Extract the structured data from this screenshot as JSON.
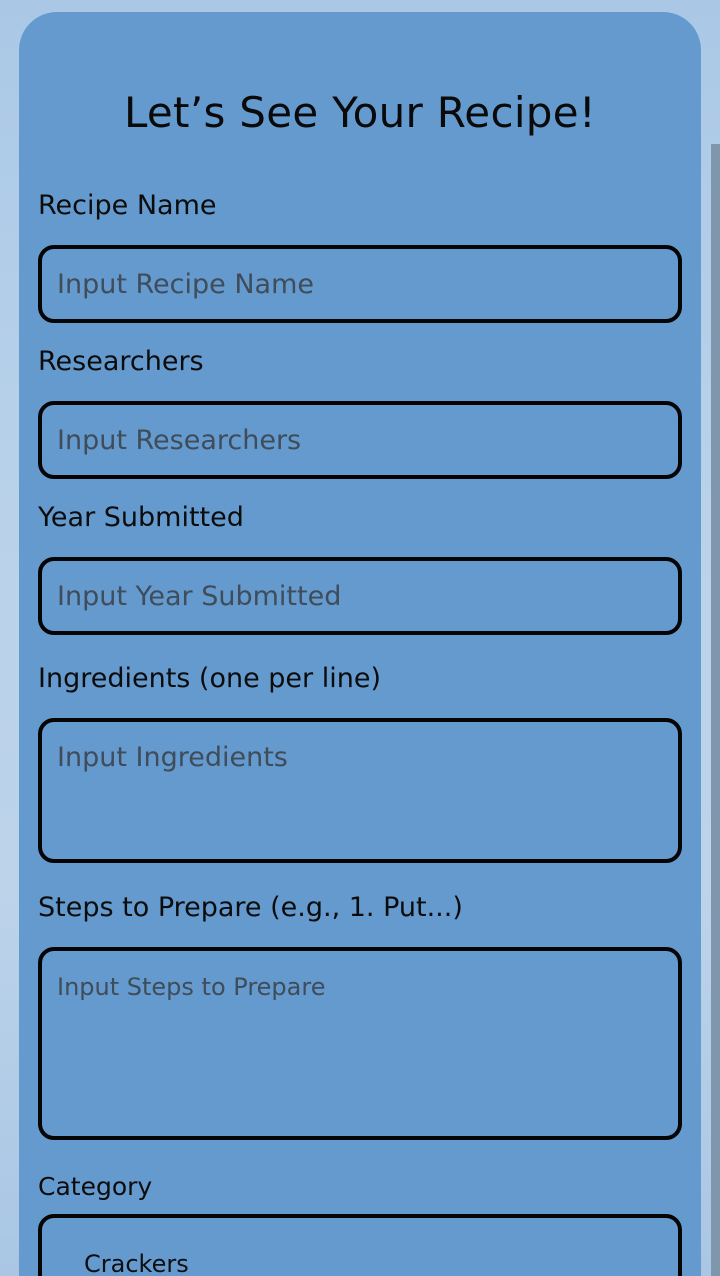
{
  "form": {
    "title": "Let’s See Your Recipe!",
    "recipe_name": {
      "label": "Recipe Name",
      "placeholder": "Input Recipe Name",
      "value": ""
    },
    "researchers": {
      "label": "Researchers",
      "placeholder": "Input Researchers",
      "value": ""
    },
    "year_submitted": {
      "label": "Year Submitted",
      "placeholder": "Input Year Submitted",
      "value": ""
    },
    "ingredients": {
      "label": "Ingredients (one per line)",
      "placeholder": "Input Ingredients",
      "value": ""
    },
    "steps": {
      "label": "Steps to Prepare (e.g., 1. Put...)",
      "placeholder": "Input Steps to Prepare",
      "value": ""
    },
    "category": {
      "label": "Category",
      "selected": "Crackers"
    }
  },
  "colors": {
    "card_background": "#659ace",
    "page_background": "#b9d2ea",
    "border": "#050505"
  }
}
